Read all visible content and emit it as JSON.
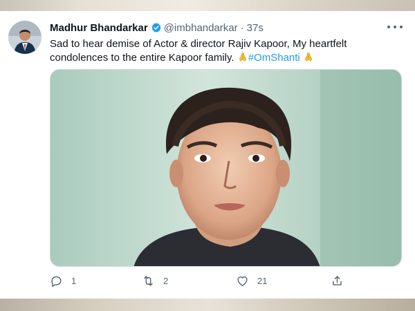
{
  "tweet": {
    "author_name": "Madhur Bhandarkar",
    "handle": "@imbhandarkar",
    "separator": "·",
    "time": "37s",
    "text_main": "Sad to hear demise of Actor & director Rajiv Kapoor, My heartfelt condolences to the entire Kapoor family.",
    "hashtag": "#OmShanti",
    "verified_icon": "verified-badge-icon",
    "more_icon": "more-icon",
    "emoji_icon": "folded-hands-emoji",
    "accent_color": "#1d9bf0",
    "counts": {
      "reply": "1",
      "retweet": "2",
      "like": "21"
    }
  }
}
